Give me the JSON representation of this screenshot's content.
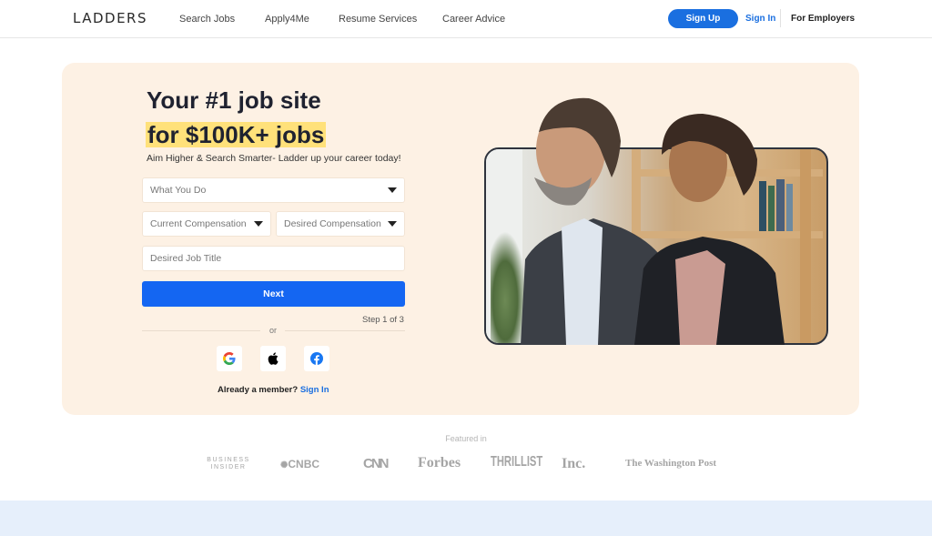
{
  "header": {
    "logo": "LADDERS",
    "nav": [
      "Search Jobs",
      "Apply4Me",
      "Resume Services",
      "Career Advice"
    ],
    "sign_up": "Sign Up",
    "sign_in": "Sign In",
    "for_employers": "For Employers"
  },
  "hero": {
    "headline_line1": "Your #1 job site",
    "headline_line2": "for $100K+ jobs",
    "subheadline": "Aim Higher & Search Smarter- Ladder up your career today!",
    "form": {
      "what_you_do": "What You Do",
      "current_compensation": "Current Compensation",
      "desired_compensation": "Desired Compensation",
      "desired_job_title_placeholder": "Desired Job Title",
      "next_label": "Next",
      "step_text": "Step 1 of 3",
      "or_text": "or"
    },
    "social": [
      {
        "icon": "google-icon"
      },
      {
        "icon": "apple-icon"
      },
      {
        "icon": "facebook-icon"
      }
    ],
    "already_member": "Already a member?",
    "sign_in_link": "Sign In"
  },
  "featured": {
    "label": "Featured in",
    "outlets": [
      "BUSINESS INSIDER",
      "CNBC",
      "CNN",
      "Forbes",
      "THRILLIST",
      "Inc.",
      "The Washington Post"
    ]
  },
  "colors": {
    "accent": "#1466f2",
    "hero_bg": "#fdf1e4",
    "highlight": "#ffe17a",
    "band": "#e6effb"
  }
}
